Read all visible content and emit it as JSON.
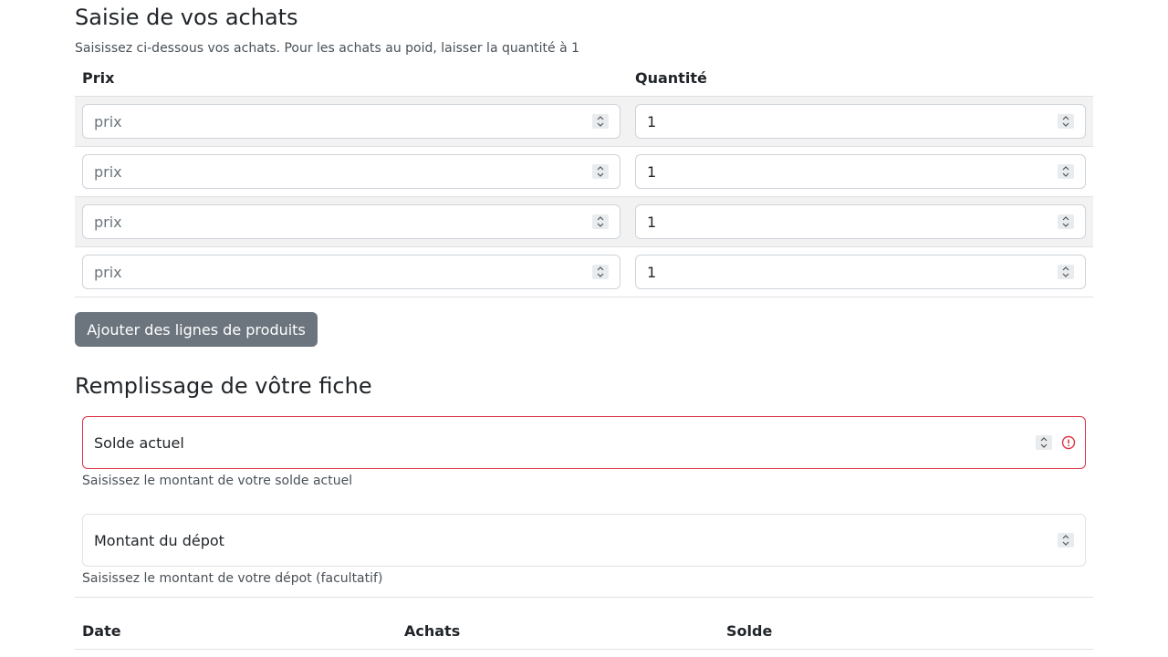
{
  "purchases": {
    "title": "Saisie de vos achats",
    "subtitle": "Saisissez ci-dessous vos achats. Pour les achats au poid, laisser la quantité à 1",
    "columns": {
      "price": "Prix",
      "quantity": "Quantité"
    },
    "rows": [
      {
        "price_placeholder": "prix",
        "quantity": "1"
      },
      {
        "price_placeholder": "prix",
        "quantity": "1"
      },
      {
        "price_placeholder": "prix",
        "quantity": "1"
      },
      {
        "price_placeholder": "prix",
        "quantity": "1"
      }
    ],
    "add_button_label": "Ajouter des lignes de produits"
  },
  "sheet": {
    "title": "Remplissage de vôtre fiche",
    "current_balance": {
      "label": "Solde actuel",
      "help": "Saisissez le montant de votre solde actuel",
      "status_color": "#dc3545"
    },
    "deposit": {
      "label": "Montant du dépot",
      "help": "Saisissez le montant de votre dépot (facultatif)"
    }
  },
  "history": {
    "columns": {
      "date": "Date",
      "purchases": "Achats",
      "balance": "Solde"
    }
  },
  "icons": {
    "spinner": "chevron-up-down-icon",
    "error": "exclamation-circle-icon"
  }
}
